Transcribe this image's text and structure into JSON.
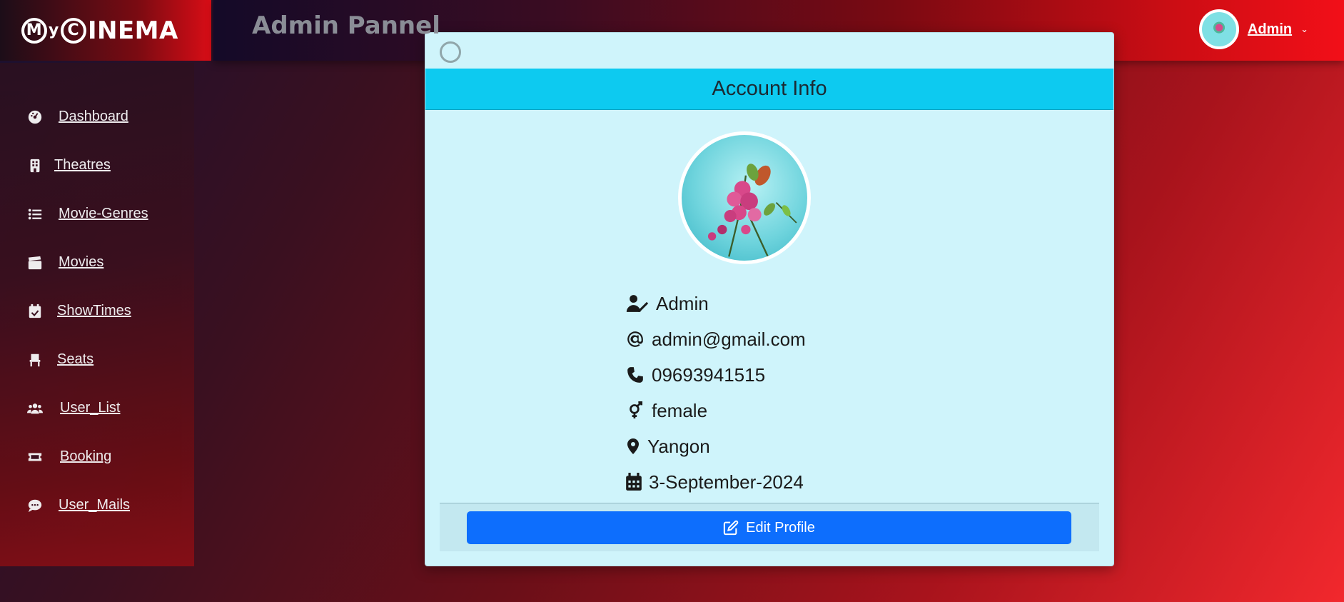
{
  "brand": {
    "logo_text": "My Cinema"
  },
  "header": {
    "title": "Admin Pannel",
    "user_name": "Admin"
  },
  "sidebar": {
    "items": [
      {
        "label": "Dashboard",
        "icon": "dashboard-icon"
      },
      {
        "label": "Theatres",
        "icon": "building-icon"
      },
      {
        "label": "Movie-Genres",
        "icon": "list-icon"
      },
      {
        "label": "Movies",
        "icon": "clapperboard-icon"
      },
      {
        "label": "ShowTimes",
        "icon": "calendar-check-icon"
      },
      {
        "label": "Seats",
        "icon": "chair-icon"
      },
      {
        "label": "User_List",
        "icon": "users-icon"
      },
      {
        "label": "Booking",
        "icon": "ticket-icon"
      },
      {
        "label": "User_Mails",
        "icon": "chat-icon"
      }
    ]
  },
  "modal": {
    "title": "Account Info",
    "info": {
      "name": "Admin",
      "email": "admin@gmail.com",
      "phone": "09693941515",
      "gender": "female",
      "location": "Yangon",
      "date": "3-September-2024"
    },
    "edit_button_label": "Edit Profile"
  },
  "colors": {
    "modal_header": "#0dcaf0",
    "modal_body": "#cff4fb",
    "primary_button": "#0d6efd"
  }
}
